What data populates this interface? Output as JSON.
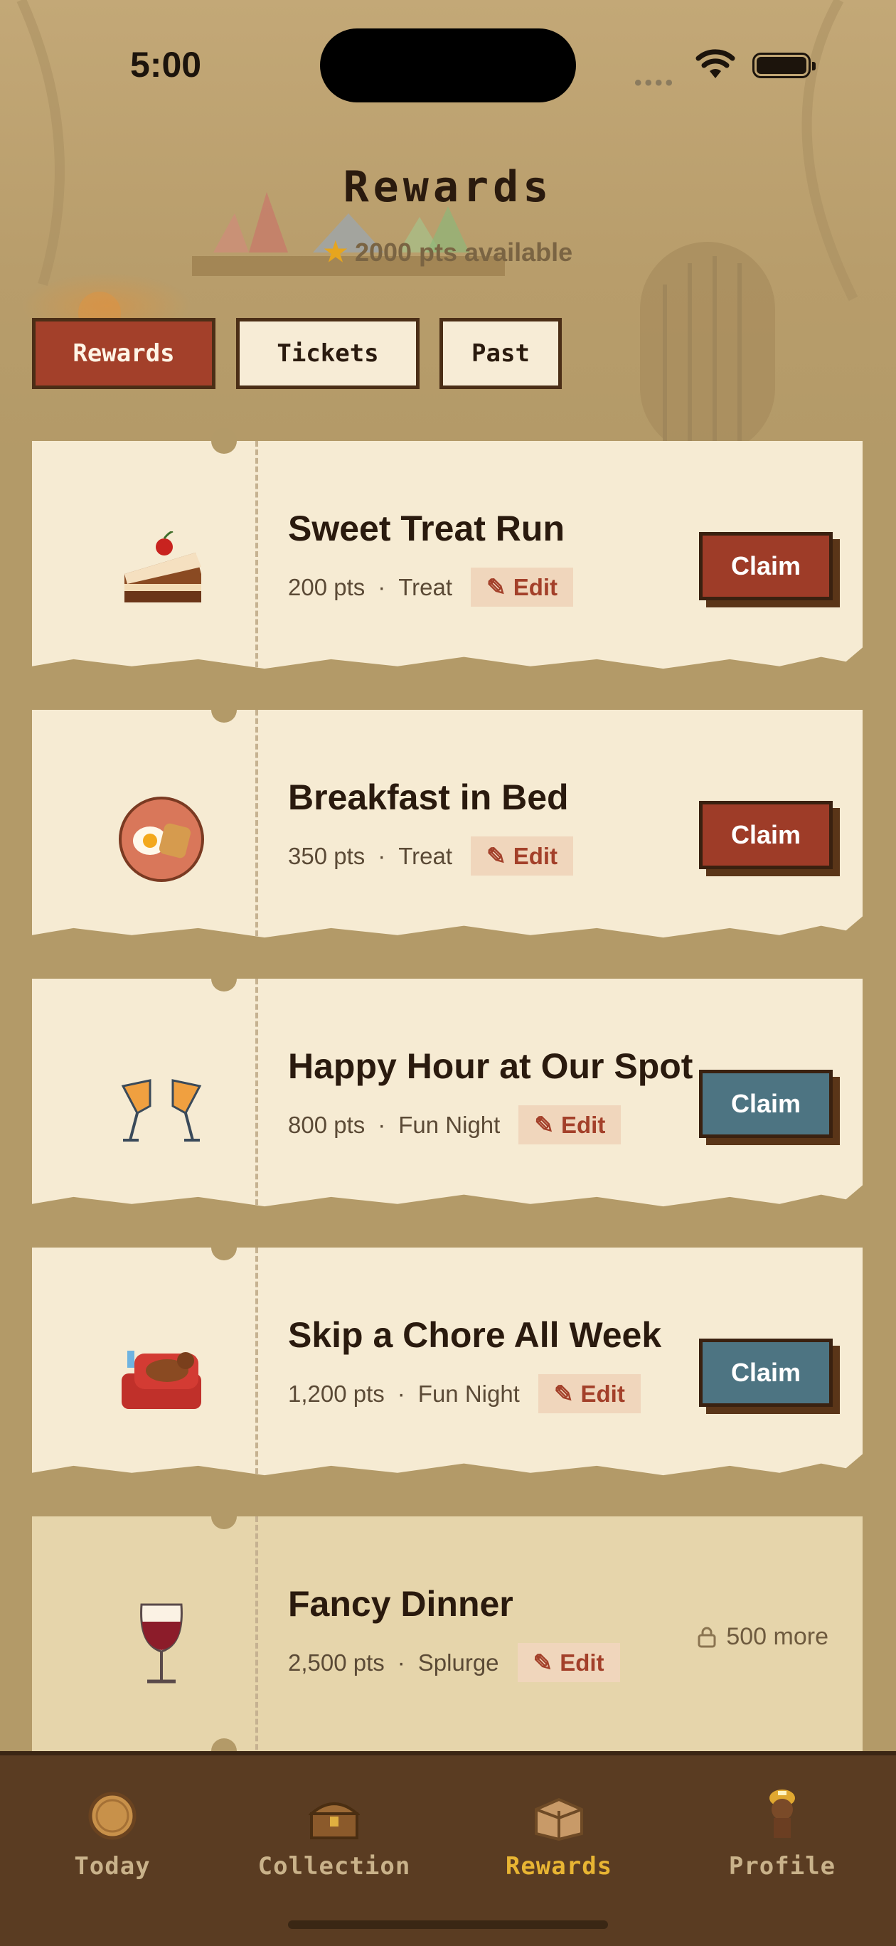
{
  "status_bar": {
    "time": "5:00"
  },
  "header": {
    "title": "Rewards",
    "points_available": "2000 pts available",
    "points_icon": "star-icon"
  },
  "tabs": [
    {
      "label": "Rewards",
      "active": true
    },
    {
      "label": "Tickets",
      "active": false
    },
    {
      "label": "Past",
      "active": false
    }
  ],
  "rewards": [
    {
      "name": "Sweet Treat Run",
      "points": "200 pts",
      "category": "Treat",
      "edit_label": "Edit",
      "action": "Claim",
      "action_color": "#9e3c28",
      "icon": "cake-icon"
    },
    {
      "name": "Breakfast in Bed",
      "points": "350 pts",
      "category": "Treat",
      "edit_label": "Edit",
      "action": "Claim",
      "action_color": "#9e3c28",
      "icon": "breakfast-plate-icon"
    },
    {
      "name": "Happy Hour at Our Spot",
      "points": "800 pts",
      "category": "Fun Night",
      "edit_label": "Edit",
      "action": "Claim",
      "action_color": "#4d7482",
      "icon": "cheers-glasses-icon"
    },
    {
      "name": "Skip a Chore All Week",
      "points": "1,200 pts",
      "category": "Fun Night",
      "edit_label": "Edit",
      "action": "Claim",
      "action_color": "#4d7482",
      "icon": "dog-armchair-icon"
    },
    {
      "name": "Fancy Dinner",
      "points": "2,500 pts",
      "category": "Splurge",
      "edit_label": "Edit",
      "locked_text": "500 more",
      "icon": "wine-glass-icon"
    }
  ],
  "bottom_nav": [
    {
      "label": "Today",
      "icon": "coin-icon",
      "active": false
    },
    {
      "label": "Collection",
      "icon": "treasure-chest-icon",
      "active": false
    },
    {
      "label": "Rewards",
      "icon": "crate-icon",
      "active": true
    },
    {
      "label": "Profile",
      "icon": "dog-miner-icon",
      "active": false
    }
  ]
}
